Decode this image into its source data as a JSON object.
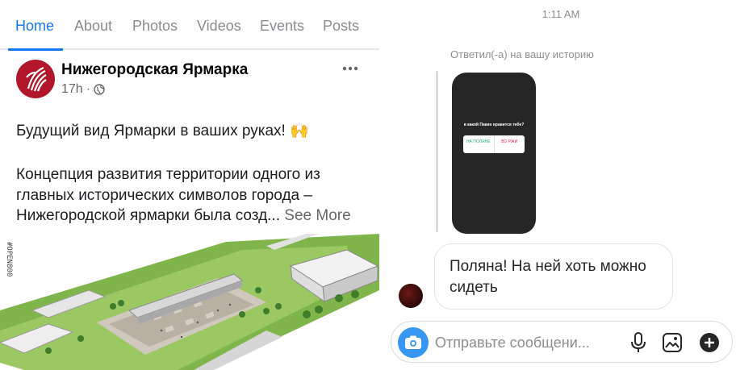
{
  "facebook": {
    "tabs": [
      {
        "label": "Home",
        "active": true
      },
      {
        "label": "About",
        "active": false
      },
      {
        "label": "Photos",
        "active": false
      },
      {
        "label": "Videos",
        "active": false
      },
      {
        "label": "Events",
        "active": false
      },
      {
        "label": "Posts",
        "active": false
      }
    ],
    "post": {
      "page_name": "Нижегородская Ярмарка",
      "time": "17h",
      "audience_icon": "globe-icon",
      "more_icon": "more-dots-icon",
      "text_line_1": "Будущий вид Ярмарки в ваших руках! 🙌",
      "text_line_2": "Концепция развития территории одного из",
      "text_line_3": "главных исторических символов города –",
      "text_line_4": "Нижегородской ярмарки была созд...",
      "see_more": "See More",
      "image_watermark": "#OPEN800"
    },
    "accent_color": "#1877f2"
  },
  "instagram": {
    "time": "1:11 AM",
    "reply_caption": "Ответил(-а) на вашу историю",
    "story": {
      "question": "в какой Пакин нравится тебе?",
      "option_a": "НА ПОЛЯНЕ",
      "option_b": "ВО РЖИ"
    },
    "message": "Поляна! На ней хоть можно сидеть",
    "composer": {
      "placeholder": "Отправьте сообщени...",
      "icons": [
        "camera-icon",
        "microphone-icon",
        "gallery-icon",
        "plus-icon"
      ]
    },
    "accent_color": "#3897f0"
  }
}
